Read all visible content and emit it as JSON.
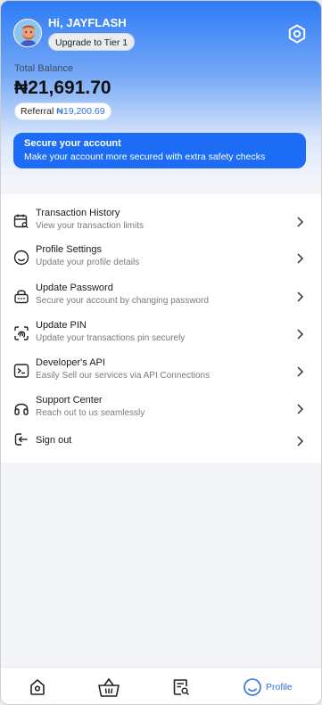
{
  "header": {
    "greeting": "Hi, JAYFLASH",
    "tier_button": "Upgrade to Tier 1",
    "balance_label": "Total Balance",
    "balance_amount": "₦21,691.70",
    "referral_label": "Referral",
    "referral_value": "₦19,200.69"
  },
  "secure_card": {
    "title": "Secure your account",
    "subtitle": "Make your account more secured with extra safety checks"
  },
  "menu": {
    "items": [
      {
        "title": "Transaction History",
        "subtitle": "View your transaction limits",
        "icon": "calendar-search-icon"
      },
      {
        "title": "Profile Settings",
        "subtitle": "Update your profile details",
        "icon": "smiley-icon"
      },
      {
        "title": "Update Password",
        "subtitle": "Secure your account by changing password",
        "icon": "lock-icon"
      },
      {
        "title": "Update PIN",
        "subtitle": "Update your transactions pin securely",
        "icon": "fingerprint-icon"
      },
      {
        "title": "Developer's API",
        "subtitle": "Easily Sell our services via API Connections",
        "icon": "terminal-icon"
      },
      {
        "title": "Support Center",
        "subtitle": "Reach out to us seamlessly",
        "icon": "headphones-icon"
      },
      {
        "title": "Sign out",
        "subtitle": "",
        "icon": "sign-out-icon"
      }
    ]
  },
  "bottom_nav": {
    "profile_label": "Profile"
  },
  "colors": {
    "accent": "#1d6cf5",
    "link": "#2f6fe8"
  }
}
